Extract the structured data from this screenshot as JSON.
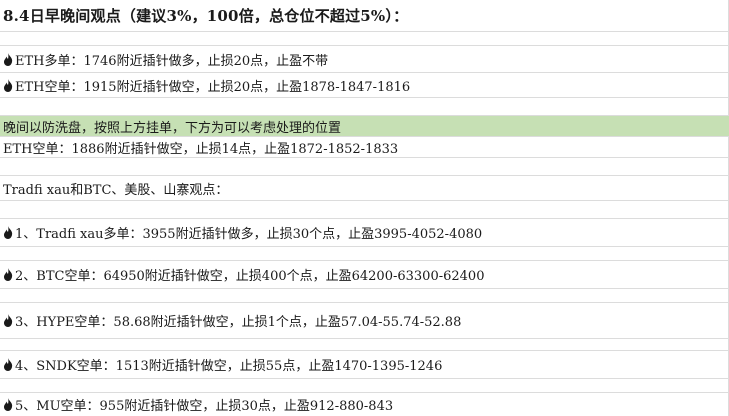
{
  "title": "8.4日早晚间观点（建议3%，100倍，总仓位不超过5%）：",
  "lines": [
    {
      "icon": "fire-icon",
      "text": "ETH多单：1746附近插针做多，止损20点，止盈不带"
    },
    {
      "icon": "fire-icon",
      "text": "ETH空单：1915附近插针做空，止损20点，止盈1878-1847-1816"
    },
    {
      "text": "晚间以防洗盘，按照上方挂单，下方为可以考虑处理的位置"
    },
    {
      "text": "ETH空单：1886附近插针做空，止损14点，止盈1872-1852-1833"
    },
    {
      "text": "Tradfi xau和BTC、美股、山寨观点："
    },
    {
      "icon": "fire-icon",
      "text": "1、Tradfi xau多单：3955附近插针做多，止损30个点，止盈3995-4052-4080"
    },
    {
      "icon": "fire-icon",
      "text": "2、BTC空单：64950附近插针做空，止损400个点，止盈64200-63300-62400"
    },
    {
      "icon": "fire-icon",
      "text": "3、HYPE空单：58.68附近插针做空，止损1个点，止盈57.04-55.74-52.88"
    },
    {
      "icon": "fire-icon",
      "text": "4、SNDK空单：1513附近插针做空，止损55点，止盈1470-1395-1246"
    },
    {
      "icon": "fire-icon",
      "text": "5、MU空单：955附近插针做空，止损30点，止盈912-880-843"
    }
  ],
  "colors": {
    "highlight": "#c6e0b4",
    "grid": "#dcdcdc",
    "icon": "#1a1a1a"
  }
}
